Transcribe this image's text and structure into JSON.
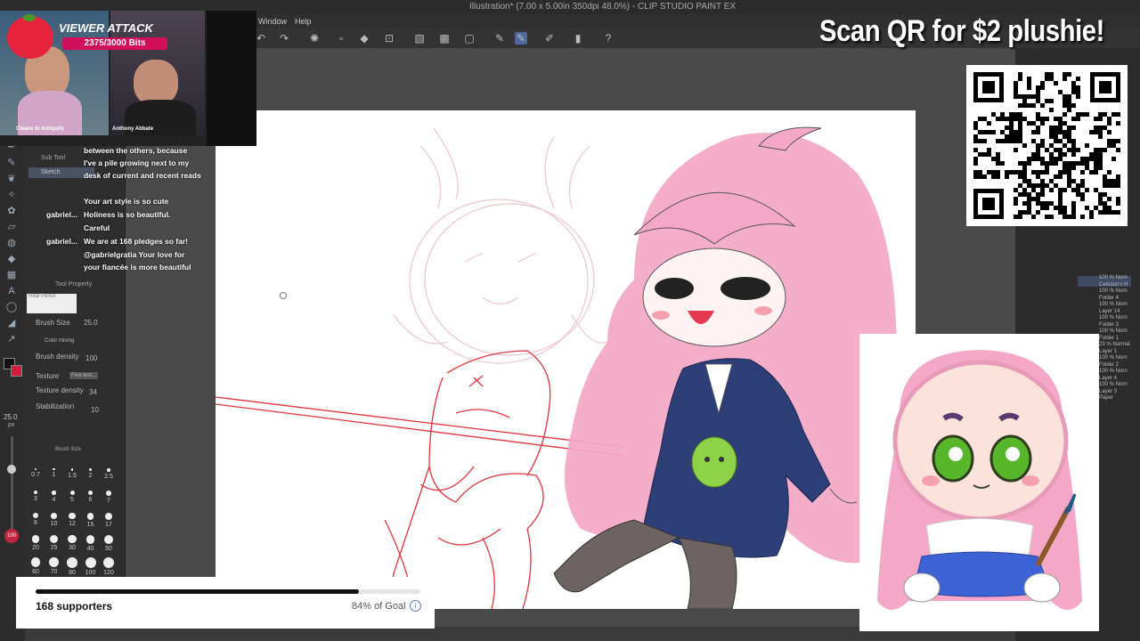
{
  "window": {
    "title": "Illustration* (7.00 x 5.00in 350dpi 48.0%) - CLIP STUDIO PAINT EX"
  },
  "menu": {
    "items": [
      "Window",
      "Help"
    ]
  },
  "alert": {
    "title": "VIEWER ATTACK",
    "bits": "2375/3000 Bits"
  },
  "webcam": {
    "left_name": "Cleave to Antiquity",
    "right_name": "Anthony Abbate"
  },
  "chat": {
    "lines": [
      "between the others, because",
      "I've a pile growing next to my",
      "desk of current and recent reads",
      "Your art style is so cute",
      "Holiness is so beautiful.",
      "Careful",
      "We are at 168 pledges so far!",
      "@gabrielgratia Your love for",
      "your fiancée is more beautiful"
    ],
    "users": [
      "gabriel...",
      "gabriel..."
    ]
  },
  "subtool": {
    "header": "Sub Tool",
    "active": "Sketch",
    "tool_property": "Tool Property",
    "brush_name": "Real Pencil",
    "brush_size_label": "Brush Size",
    "brush_size_value": "25.0",
    "color_mixing": "Color mixing",
    "brush_density_label": "Brush density",
    "brush_density_value": "100",
    "texture_label": "Texture",
    "texture_value": "Fine text...",
    "texture_density_label": "Texture density",
    "texture_density_value": "34",
    "stabilization_label": "Stabilization",
    "stabilization_value": "10",
    "brush_size_panel": "Brush Size",
    "size_readout": "25.0",
    "size_unit": "px",
    "opacity_readout": "100",
    "sizes": [
      "0.7",
      "1",
      "1.5",
      "2",
      "2.5",
      "3",
      "4",
      "5",
      "6",
      "7",
      "8",
      "10",
      "12",
      "15",
      "17",
      "20",
      "25",
      "30",
      "40",
      "50",
      "60",
      "70",
      "80",
      "100",
      "120"
    ]
  },
  "layers": {
    "items": [
      "100 % Norn\nCeledun's H",
      "100 % Norn\nFolder 4",
      "100 % Norn\nLayer 14",
      "100 % Norn\nFolder 3",
      "100 % Norn\nFolder 1",
      "23 % Normal\nLayer 1",
      "100 % Norn\nFolder 2",
      "100 % Norn\nLayer 4",
      "100 % Norn\nLayer 3",
      "Paper"
    ]
  },
  "overlay": {
    "qr_title": "Scan QR for $2 plushie!"
  },
  "goal": {
    "supporters": "168 supporters",
    "percent_text": "84% of Goal",
    "info": "i",
    "progress": 0.84
  },
  "colors": {
    "accent": "#d10f5a",
    "hair": "#f4a7c6",
    "suit": "#2e3f77",
    "sketch": "#e0333c"
  }
}
